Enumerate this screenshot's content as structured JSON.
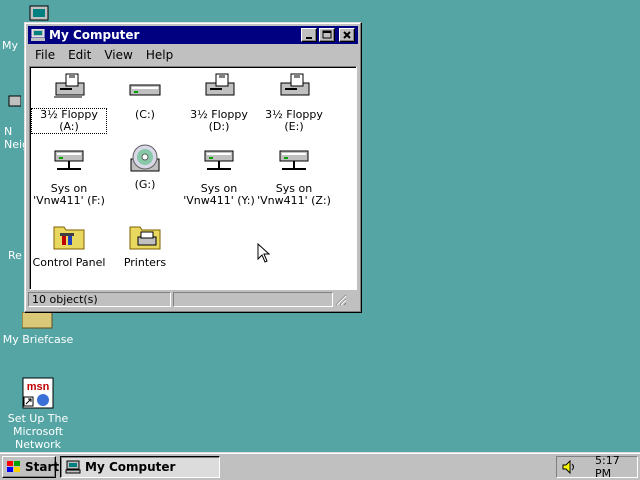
{
  "desktop": {
    "icons": [
      {
        "label": "My"
      },
      {
        "label": "N\nNeig"
      },
      {
        "label": "Re"
      },
      {
        "label": "My Briefcase"
      },
      {
        "label": "Set Up The\nMicrosoft\nNetwork"
      }
    ]
  },
  "window": {
    "title": "My Computer",
    "menu": [
      "File",
      "Edit",
      "View",
      "Help"
    ],
    "items": [
      {
        "label": "3½ Floppy (A:)",
        "icon": "floppy-drive-icon"
      },
      {
        "label": "(C:)",
        "icon": "hard-drive-icon"
      },
      {
        "label": "3½ Floppy (D:)",
        "icon": "floppy-drive-icon"
      },
      {
        "label": "3½ Floppy (E:)",
        "icon": "floppy-drive-icon"
      },
      {
        "label": "Sys on\n'Vnw411' (F:)",
        "icon": "network-drive-icon"
      },
      {
        "label": "(G:)",
        "icon": "cd-drive-icon"
      },
      {
        "label": "Sys on\n'Vnw411' (Y:)",
        "icon": "network-drive-icon"
      },
      {
        "label": "Sys on\n'Vnw411' (Z:)",
        "icon": "network-drive-icon"
      },
      {
        "label": "Control Panel",
        "icon": "control-panel-folder-icon"
      },
      {
        "label": "Printers",
        "icon": "printers-folder-icon"
      }
    ],
    "status": "10 object(s)"
  },
  "taskbar": {
    "start_label": "Start",
    "task_label": "My Computer",
    "clock": "5:17 PM"
  },
  "colors": {
    "desktop": "#55a5a5",
    "titlebar": "#000080",
    "face": "#c0c0c0"
  }
}
